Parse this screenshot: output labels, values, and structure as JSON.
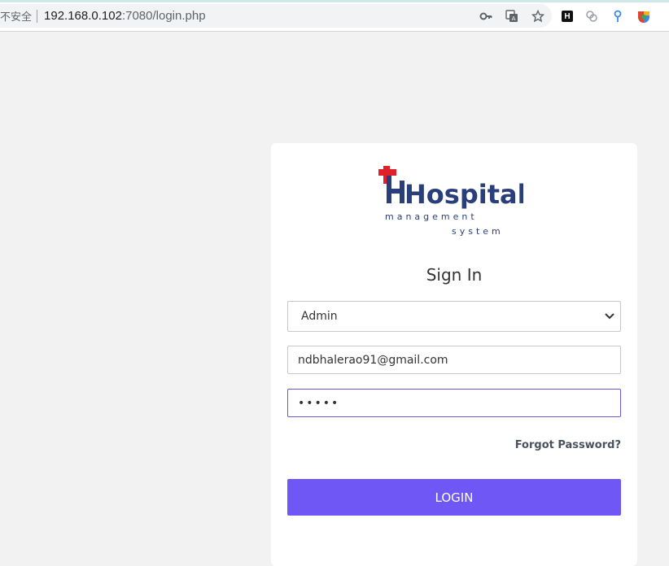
{
  "browser": {
    "security_label": "不安全",
    "url_host": "192.168.0.102",
    "url_rest": ":7080/login.php"
  },
  "logo": {
    "brand": "Hospital",
    "line1": "management",
    "line2": "system"
  },
  "login": {
    "title": "Sign In",
    "role_selected": "Admin",
    "email_value": "ndbhalerao91@gmail.com",
    "password_mask": "•••••",
    "forgot_label": "Forgot Password?",
    "submit_label": "LOGIN"
  },
  "colors": {
    "accent": "#6f57f5",
    "background": "#f2f2f2",
    "logo_blue": "#2a3f7a",
    "logo_red": "#e0202a"
  }
}
